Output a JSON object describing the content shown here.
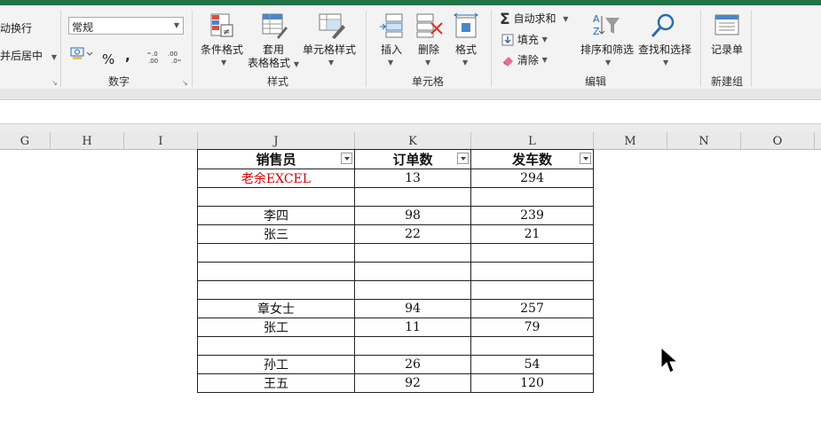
{
  "ribbon": {
    "alignment": {
      "wrap_text": "动换行",
      "merge_center": "并后居中"
    },
    "number": {
      "format_value": "常规",
      "percent_symbol": "%",
      "comma_symbol": ",",
      "group_label": "数字"
    },
    "styles": {
      "conditional_format": "条件格式",
      "table_format_line1": "套用",
      "table_format_line2": "表格格式",
      "cell_styles": "单元格样式",
      "group_label": "样式"
    },
    "cells": {
      "insert": "插入",
      "delete": "删除",
      "format": "格式",
      "group_label": "单元格"
    },
    "editing": {
      "autosum": "自动求和",
      "fill": "填充",
      "clear": "清除",
      "sort_filter": "排序和筛选",
      "find_select": "查找和选择",
      "group_label": "编辑"
    },
    "new_group": {
      "record_form": "记录单",
      "group_label": "新建组"
    }
  },
  "columns": [
    "G",
    "H",
    "I",
    "J",
    "K",
    "L",
    "M",
    "N",
    "O"
  ],
  "table": {
    "headers": [
      "销售员",
      "订单数",
      "发车数"
    ],
    "rows": [
      [
        "老余EXCEL",
        "13",
        "294"
      ],
      [
        "",
        "",
        ""
      ],
      [
        "李四",
        "98",
        "239"
      ],
      [
        "张三",
        "22",
        "21"
      ],
      [
        "",
        "",
        ""
      ],
      [
        "",
        "",
        ""
      ],
      [
        "",
        "",
        ""
      ],
      [
        "章女士",
        "94",
        "257"
      ],
      [
        "张工",
        "11",
        "79"
      ],
      [
        "",
        "",
        ""
      ],
      [
        "孙工",
        "26",
        "54"
      ],
      [
        "王五",
        "92",
        "120"
      ]
    ],
    "highlight_color": "#d40000"
  },
  "colors": {
    "brand": "#217346"
  }
}
